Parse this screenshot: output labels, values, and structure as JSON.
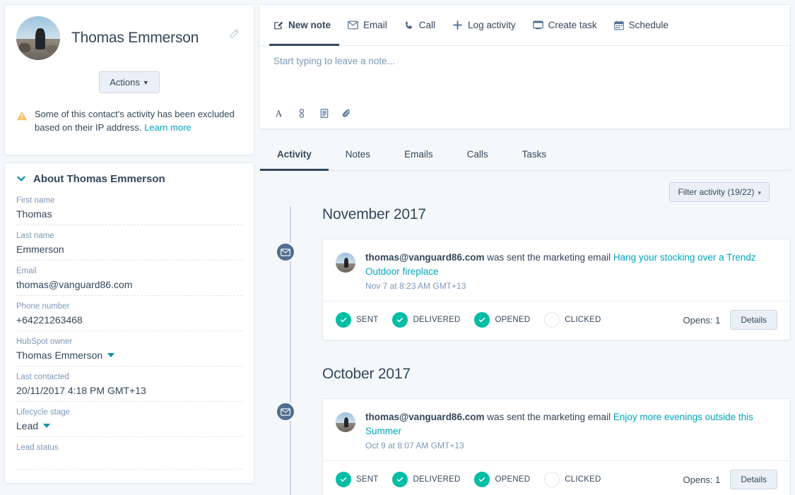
{
  "contact": {
    "name": "Thomas Emmerson",
    "avatar_icon": "user-photo-avatar",
    "edit_icon": "pencil-icon",
    "actions_label": "Actions",
    "alert_icon": "warning-triangle-icon",
    "alert_text": "Some of this contact's activity has been excluded based on their IP address.",
    "alert_link": "Learn more"
  },
  "about": {
    "heading": "About Thomas Emmerson",
    "collapse_icon": "chevron-down-icon",
    "properties": [
      {
        "label": "First name",
        "value": "Thomas",
        "type": "text"
      },
      {
        "label": "Last name",
        "value": "Emmerson",
        "type": "text"
      },
      {
        "label": "Email",
        "value": "thomas@vanguard86.com",
        "type": "text"
      },
      {
        "label": "Phone number",
        "value": "+64221263468",
        "type": "text"
      },
      {
        "label": "HubSpot owner",
        "value": "Thomas Emmerson",
        "type": "dropdown"
      },
      {
        "label": "Last contacted",
        "value": "20/11/2017 4:18 PM GMT+13",
        "type": "text"
      },
      {
        "label": "Lifecycle stage",
        "value": "Lead",
        "type": "dropdown"
      },
      {
        "label": "Lead status",
        "value": "",
        "type": "text"
      }
    ]
  },
  "composer": {
    "tabs": [
      {
        "label": "New note",
        "icon": "note-pencil-icon",
        "active": true
      },
      {
        "label": "Email",
        "icon": "envelope-icon",
        "active": false
      },
      {
        "label": "Call",
        "icon": "phone-icon",
        "active": false
      },
      {
        "label": "Log activity",
        "icon": "plus-icon",
        "active": false
      },
      {
        "label": "Create task",
        "icon": "task-card-icon",
        "active": false
      },
      {
        "label": "Schedule",
        "icon": "calendar-icon",
        "active": false
      }
    ],
    "placeholder": "Start typing to leave a note...",
    "tools": [
      {
        "icon": "font-format-icon",
        "glyph": "A"
      },
      {
        "icon": "link-chain-icon",
        "glyph": "⚭"
      },
      {
        "icon": "document-icon",
        "glyph": "▤"
      },
      {
        "icon": "paperclip-attachment-icon",
        "glyph": "📎"
      }
    ]
  },
  "activity_tabs": [
    {
      "label": "Activity",
      "active": true
    },
    {
      "label": "Notes",
      "active": false
    },
    {
      "label": "Emails",
      "active": false
    },
    {
      "label": "Calls",
      "active": false
    },
    {
      "label": "Tasks",
      "active": false
    }
  ],
  "filter": {
    "label": "Filter activity (19/22)",
    "caret_icon": "chevron-down-icon"
  },
  "timeline": [
    {
      "month": "November 2017",
      "events": [
        {
          "dot_icon": "envelope-icon",
          "avatar_icon": "user-photo-avatar",
          "who": "thomas@vanguard86.com",
          "action": " was sent the marketing email ",
          "subject": "Hang your stocking over a Trendz Outdoor fireplace",
          "time": "Nov 7 at 8:23 AM GMT+13",
          "statuses": [
            {
              "label": "SENT",
              "done": true
            },
            {
              "label": "DELIVERED",
              "done": true
            },
            {
              "label": "OPENED",
              "done": true
            },
            {
              "label": "CLICKED",
              "done": false
            }
          ],
          "opens": "Opens: 1",
          "details_label": "Details"
        }
      ]
    },
    {
      "month": "October 2017",
      "events": [
        {
          "dot_icon": "envelope-icon",
          "avatar_icon": "user-photo-avatar",
          "who": "thomas@vanguard86.com",
          "action": " was sent the marketing email ",
          "subject": "Enjoy more evenings outside this Summer",
          "time": "Oct 9 at 8:07 AM GMT+13",
          "statuses": [
            {
              "label": "SENT",
              "done": true
            },
            {
              "label": "DELIVERED",
              "done": true
            },
            {
              "label": "OPENED",
              "done": true
            },
            {
              "label": "CLICKED",
              "done": false
            }
          ],
          "opens": "Opens: 1",
          "details_label": "Details"
        }
      ]
    }
  ],
  "colors": {
    "page_bg": "#f5f8fa",
    "text": "#33475b",
    "link": "#00a4bd",
    "accent_teal": "#0091ae",
    "success_green": "#00bda5",
    "warning_orange": "#f5c26b",
    "timeline_dot": "#516f90",
    "button_bg": "#eaf0f6",
    "button_border": "#cbd6e2"
  }
}
